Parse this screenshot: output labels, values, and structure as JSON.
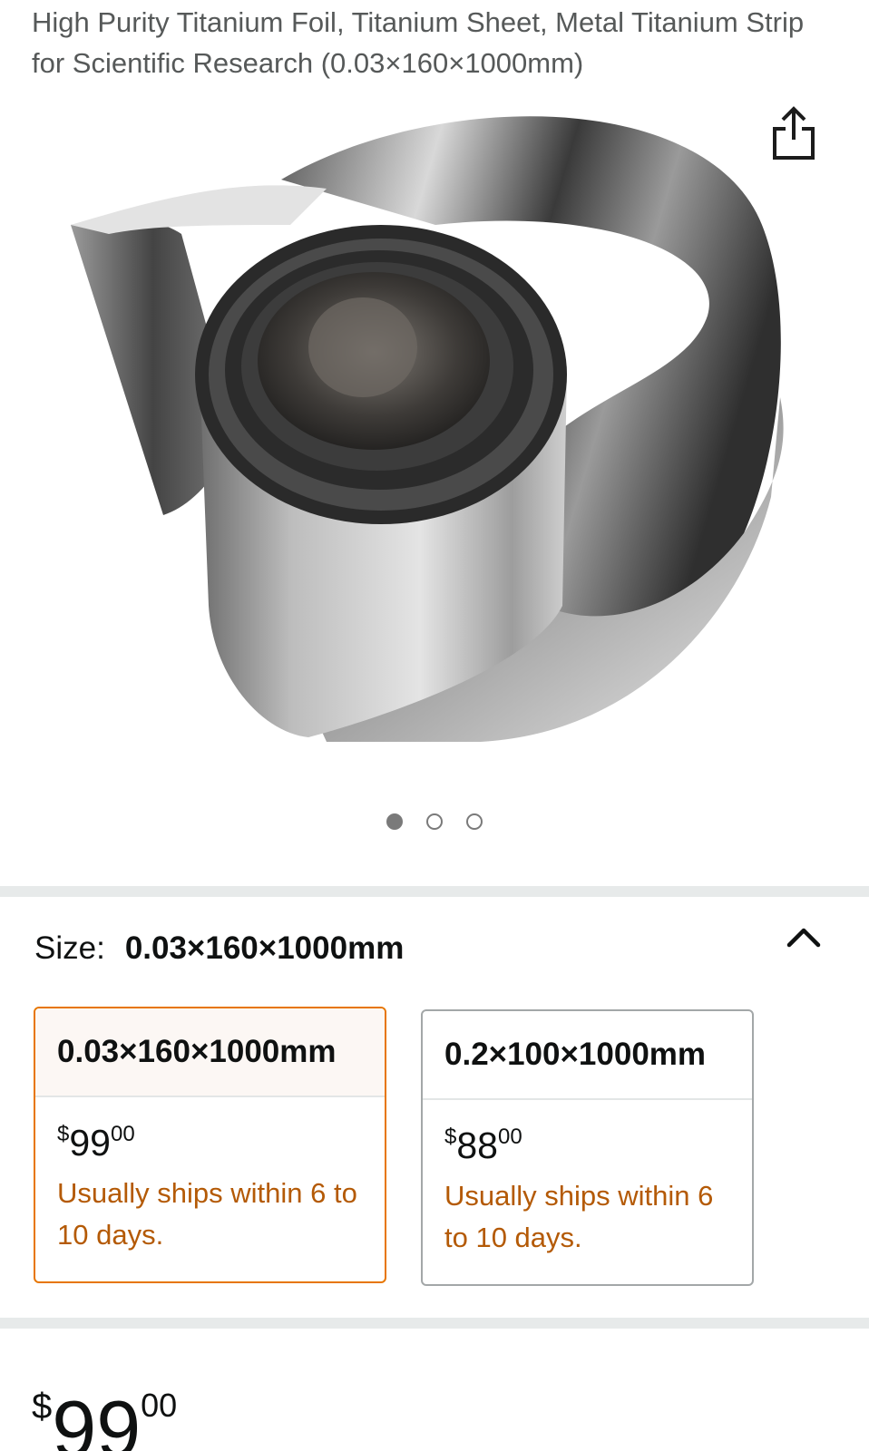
{
  "product": {
    "title": "High Purity Titanium Foil, Titanium Sheet, Metal Titanium Strip for Scientific Research (0.03×160×1000mm)"
  },
  "gallery": {
    "image_name": "titanium-foil-roll",
    "dots": [
      "active",
      "inactive",
      "inactive"
    ]
  },
  "icons": {
    "share": "share-icon",
    "collapse": "chevron-up-icon"
  },
  "size": {
    "label": "Size:",
    "selected_value": "0.03×160×1000mm"
  },
  "options": [
    {
      "name": "0.03×160×1000mm",
      "currency": "$",
      "price_whole": "99",
      "price_cents": "00",
      "shipping": "Usually ships within 6 to 10 days."
    },
    {
      "name": "0.2×100×1000mm",
      "currency": "$",
      "price_whole": "88",
      "price_cents": "00",
      "shipping": "Usually ships within 6 to 10 days."
    }
  ],
  "price": {
    "currency": "$",
    "whole": "99",
    "cents": "00"
  },
  "colors": {
    "accent": "#e77600",
    "shipping_text": "#b45a06",
    "divider": "#e7eaea"
  }
}
